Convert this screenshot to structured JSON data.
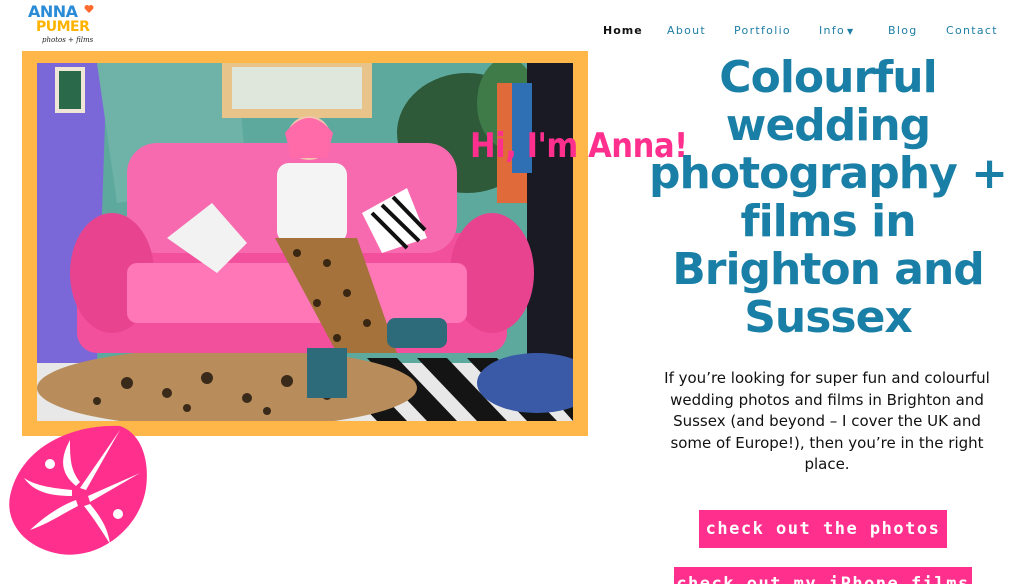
{
  "logo": {
    "line1_a": "ANNA",
    "line2_a": "PUMER",
    "line3": "photos + films",
    "icon": "heart-icon"
  },
  "nav": {
    "items": [
      {
        "label": "Home",
        "active": true
      },
      {
        "label": "About"
      },
      {
        "label": "Portfolio"
      },
      {
        "label": "Info",
        "icon": "chevron-down-icon"
      },
      {
        "label": "Blog"
      },
      {
        "label": "Contact"
      }
    ]
  },
  "hero": {
    "greeting": "Hi, I'm Anna!",
    "headline_lines": [
      "Colourful",
      "wedding",
      "photography +",
      "films in",
      "Brighton and",
      "Sussex"
    ],
    "intro": "If you’re looking for super fun and colourful wedding photos and films in Brighton and Sussex (and beyond – I cover the UK and some of Europe!), then you’re in the right place.",
    "cta_photos": "check out the photos",
    "cta_films": "check out my iPhone films"
  },
  "colors": {
    "accent_pink": "#ff2f8e",
    "teal": "#1a7fa6",
    "frame_orange": "#ffb74a"
  },
  "decorations": {
    "leaf": "monstera-leaf-icon"
  }
}
